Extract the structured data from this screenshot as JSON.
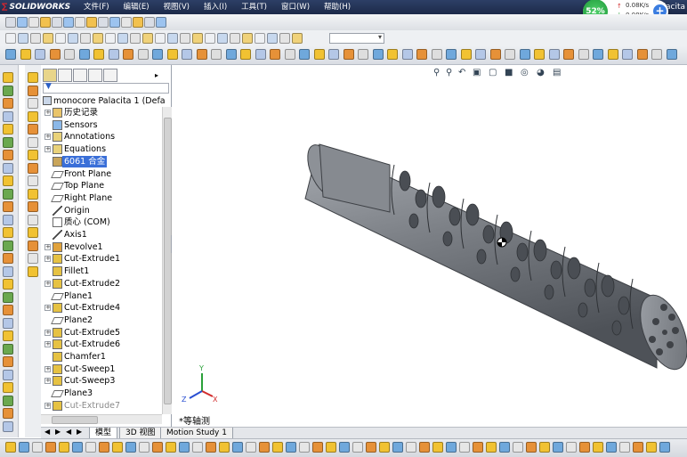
{
  "app": {
    "logo": "SOLIDWORKS",
    "title_fragment": "Palacita"
  },
  "menu": [
    {
      "label": "文件(F)"
    },
    {
      "label": "编辑(E)"
    },
    {
      "label": "视图(V)"
    },
    {
      "label": "插入(I)"
    },
    {
      "label": "工具(T)"
    },
    {
      "label": "窗口(W)"
    },
    {
      "label": "帮助(H)"
    }
  ],
  "net_widget": {
    "percent": "52%",
    "up": "0.08K/s",
    "down": "0.08K/s",
    "plus": "+"
  },
  "feature_tree": {
    "root": "monocore Palacita 1  (Defa",
    "filter_icon": "filter-icon",
    "items": [
      {
        "label": "历史记录",
        "icon": "folder-icon",
        "expand": "+"
      },
      {
        "label": "Sensors",
        "icon": "sensor-icon",
        "expand": ""
      },
      {
        "label": "Annotations",
        "icon": "annotation-icon",
        "expand": "+"
      },
      {
        "label": "Equations",
        "icon": "equation-icon",
        "expand": "+"
      },
      {
        "label": "6061 合金",
        "icon": "material-icon",
        "expand": "",
        "selected": true
      },
      {
        "label": "Front Plane",
        "icon": "plane-icon",
        "expand": ""
      },
      {
        "label": "Top Plane",
        "icon": "plane-icon",
        "expand": ""
      },
      {
        "label": "Right Plane",
        "icon": "plane-icon",
        "expand": ""
      },
      {
        "label": "Origin",
        "icon": "origin-icon",
        "expand": ""
      },
      {
        "label": "质心 (COM)",
        "icon": "com-icon",
        "expand": ""
      },
      {
        "label": "Axis1",
        "icon": "axis-icon",
        "expand": ""
      },
      {
        "label": "Revolve1",
        "icon": "revolve-icon",
        "expand": "+"
      },
      {
        "label": "Cut-Extrude1",
        "icon": "cut-extrude-icon",
        "expand": "+"
      },
      {
        "label": "Fillet1",
        "icon": "fillet-icon",
        "expand": ""
      },
      {
        "label": "Cut-Extrude2",
        "icon": "cut-extrude-icon",
        "expand": "+"
      },
      {
        "label": "Plane1",
        "icon": "plane-icon",
        "expand": ""
      },
      {
        "label": "Cut-Extrude4",
        "icon": "cut-extrude-icon",
        "expand": "+"
      },
      {
        "label": "Plane2",
        "icon": "plane-icon",
        "expand": ""
      },
      {
        "label": "Cut-Extrude5",
        "icon": "cut-extrude-icon",
        "expand": "+"
      },
      {
        "label": "Cut-Extrude6",
        "icon": "cut-extrude-icon",
        "expand": "+"
      },
      {
        "label": "Chamfer1",
        "icon": "chamfer-icon",
        "expand": ""
      },
      {
        "label": "Cut-Sweep1",
        "icon": "cut-sweep-icon",
        "expand": "+"
      },
      {
        "label": "Cut-Sweep3",
        "icon": "cut-sweep-icon",
        "expand": "+"
      },
      {
        "label": "Plane3",
        "icon": "plane-icon",
        "expand": ""
      },
      {
        "label": "Cut-Extrude7",
        "icon": "cut-extrude-icon",
        "expand": "+",
        "dim": true
      }
    ]
  },
  "viewport": {
    "view_label": "*等轴测",
    "triad": {
      "x": "X",
      "y": "Y",
      "z": "Z"
    }
  },
  "bottom_tabs": [
    {
      "label": "模型",
      "active": true
    },
    {
      "label": "3D 视图",
      "active": false
    },
    {
      "label": "Motion Study 1",
      "active": false
    }
  ],
  "colors": {
    "title_bar": "#1d2a49",
    "selection": "#3a6fd8",
    "part_gray": "#7d8187",
    "net_green": "#1f9a3a",
    "triad_x": "#d22b2b",
    "triad_y": "#2aa13a",
    "triad_z": "#2a4fd2"
  }
}
